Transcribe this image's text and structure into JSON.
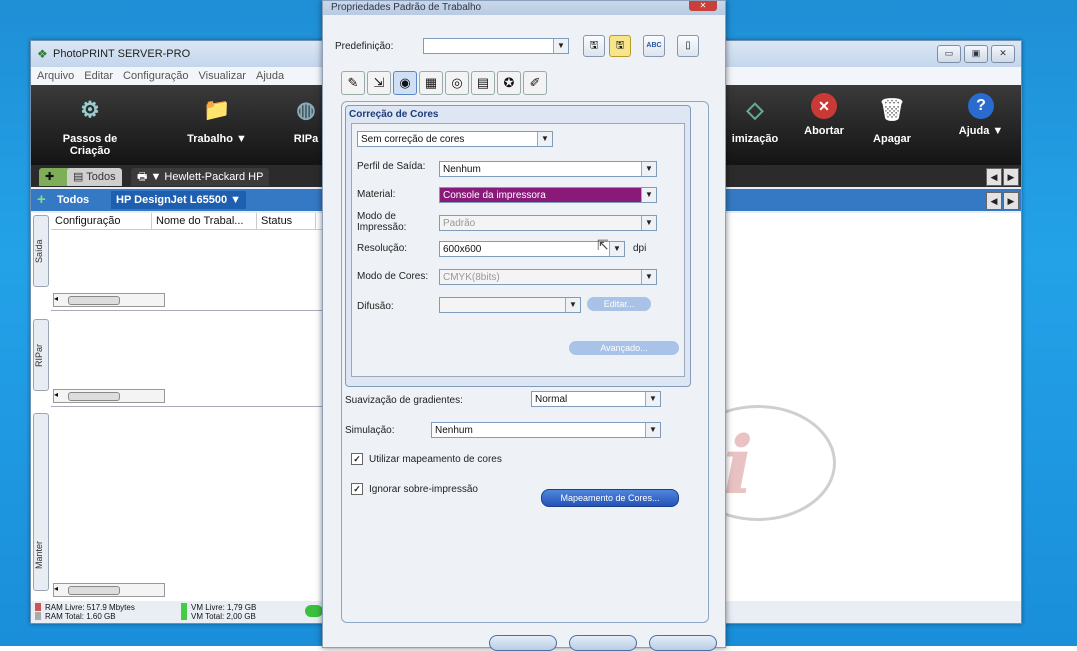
{
  "colors": {
    "desktop": "#1f8fd6",
    "toolbar": "#141414",
    "tab_blue": "#3579c4",
    "selection": "#8a1a7a",
    "accent_button": "#2f63c9"
  },
  "main": {
    "title": "PhotoPRINT SERVER-PRO",
    "menu": [
      "Arquivo",
      "Editar",
      "Configuração",
      "Visualizar",
      "Ajuda"
    ],
    "toolbar": [
      {
        "label": "Passos de Criação",
        "icon": "steps-icon"
      },
      {
        "label": "Trabalho ▼",
        "icon": "folder-icon"
      },
      {
        "label": "RIPa",
        "icon": "rip-icon"
      },
      {
        "label": "imização",
        "icon": "optimize-icon"
      },
      {
        "label": "Abortar",
        "icon": "abort-icon"
      },
      {
        "label": "Apagar",
        "icon": "trash-icon"
      },
      {
        "label": "Ajuda ▼",
        "icon": "help-icon"
      }
    ],
    "tab_all": "Todos",
    "printer_tab": "Hewlett-Packard HP",
    "sub_all": "Todos",
    "sub_device": "HP DesignJet L65500",
    "columns": [
      "Configuração",
      "Nome do Trabal...",
      "Status"
    ],
    "side_tabs": [
      "Saída",
      "RIPar",
      "Manter"
    ],
    "status": {
      "ram_free": "RAM Livre: 517.9 Mbytes",
      "ram_total": "RAM Total: 1.60 GB",
      "vm_free": "VM Livre: 1,79 GB",
      "vm_total": "VM Total: 2,00 GB"
    }
  },
  "dialog": {
    "title": "Propriedades Padrão de Trabalho",
    "preset_label": "Predefinição:",
    "preset_value": "",
    "abc": "ABC",
    "group_title": "Correção de Cores",
    "correction_mode": "Sem correção de cores",
    "profile_label": "Perfil de Saída:",
    "profile_value": "Nenhum",
    "material_label": "Material:",
    "material_value": "Console da impressora",
    "print_mode_label": "Modo de Impressão:",
    "print_mode_value": "Padrão",
    "resolution_label": "Resolução:",
    "resolution_value": "600x600",
    "dpi": "dpi",
    "color_mode_label": "Modo de Cores:",
    "color_mode_value": "CMYK(8bits)",
    "diffusion_label": "Difusão:",
    "diffusion_value": "",
    "edit_button": "Editar...",
    "advanced_button": "Avançado...",
    "gradient_label": "Suavização de gradientes:",
    "gradient_value": "Normal",
    "simulation_label": "Simulação:",
    "simulation_value": "Nenhum",
    "use_color_mapping": "Utilizar mapeamento de cores",
    "ignore_overprint": "Ignorar sobre-impressão",
    "color_mapping_button": "Mapeamento de Cores..."
  }
}
